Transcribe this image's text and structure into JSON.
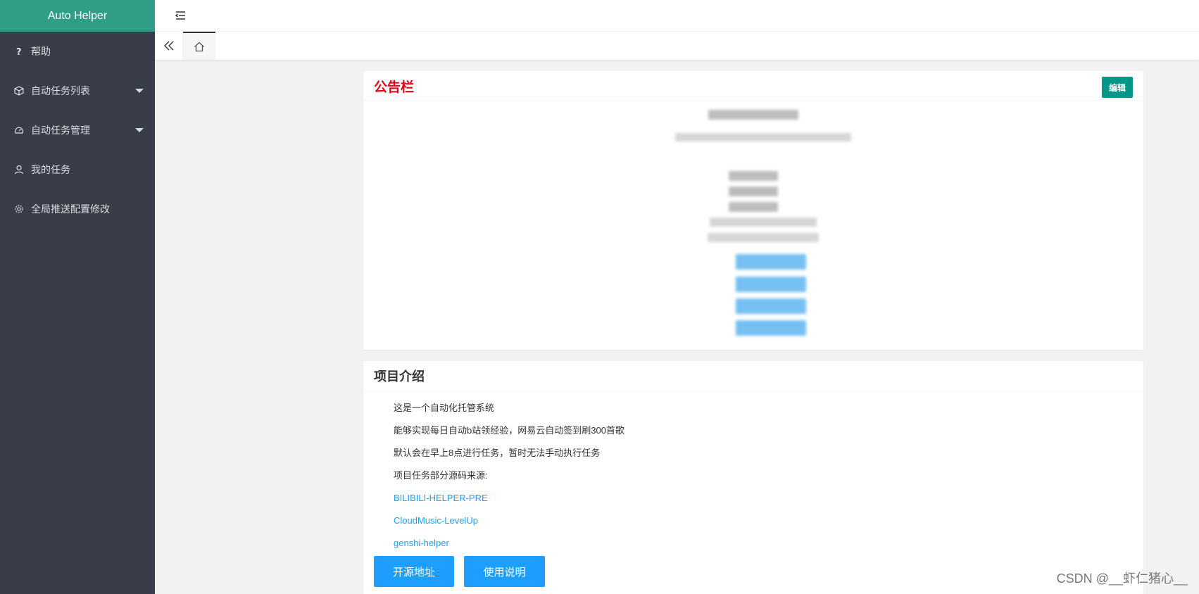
{
  "app": {
    "title": "Auto Helper"
  },
  "sidebar": {
    "items": [
      {
        "label": "帮助",
        "icon": "question-icon",
        "expandable": false
      },
      {
        "label": "自动任务列表",
        "icon": "cube-icon",
        "expandable": true
      },
      {
        "label": "自动任务管理",
        "icon": "gauge-icon",
        "expandable": true
      },
      {
        "label": "我的任务",
        "icon": "user-icon",
        "expandable": false
      },
      {
        "label": "全局推送配置修改",
        "icon": "gear-icon",
        "expandable": false
      }
    ]
  },
  "header": {
    "menu_icon": "menu-fold-icon"
  },
  "tabs": {
    "prev_icon": "double-chevron-left-icon",
    "home_icon": "home-icon"
  },
  "notice": {
    "title": "公告栏",
    "edit_label": "编辑"
  },
  "intro": {
    "title": "项目介绍",
    "lines": [
      "这是一个自动化托管系统",
      "能够实现每日自动b站领经验，网易云自动签到刷300首歌",
      "默认会在早上8点进行任务，暂时无法手动执行任务",
      "项目任务部分源码来源:"
    ],
    "links": [
      "BILIBILI-HELPER-PRE",
      "CloudMusic-LevelUp",
      "genshi-helper"
    ],
    "buttons": {
      "source": "开源地址",
      "usage": "使用说明"
    }
  },
  "watermark": "CSDN @__虾仁猪心__",
  "colors": {
    "sidebar_bg": "#393d49",
    "logo_bg": "#2f9e87",
    "accent_blue": "#1e9fff",
    "edit_green": "#009688",
    "notice_red": "#e60012"
  }
}
